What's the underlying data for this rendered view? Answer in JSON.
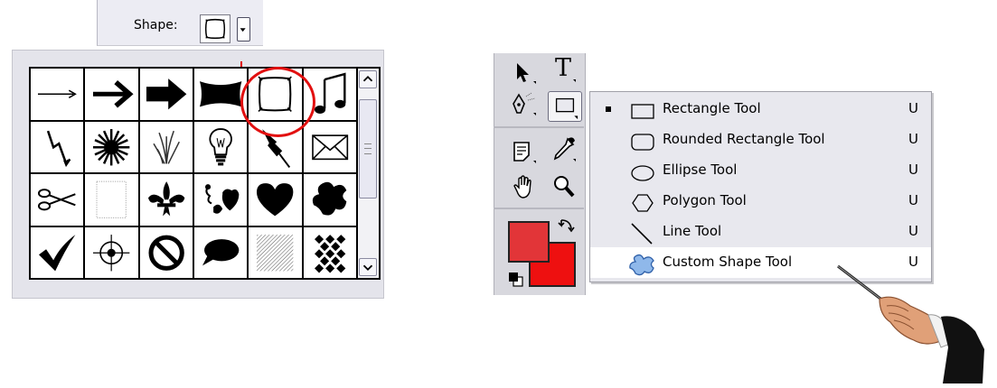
{
  "options_bar": {
    "shape_label": "Shape:",
    "dropdown_icon": "triangle-down-icon"
  },
  "shape_picker": {
    "shapes": [
      "thin-arrow-icon",
      "bold-arrow-icon",
      "heavy-arrow-icon",
      "banner-icon",
      "frame-icon",
      "music-note-icon",
      "lightning-icon",
      "starburst-icon",
      "grass-icon",
      "lightbulb-icon",
      "pushpin-icon",
      "envelope-icon",
      "scissors-icon",
      "dotted-frame-icon",
      "fleur-de-lis-icon",
      "floral-heart-icon",
      "heart-icon",
      "puzzle-blob-icon",
      "checkmark-icon",
      "crosshair-icon",
      "no-symbol-icon",
      "speech-bubble-icon",
      "hatched-square-icon",
      "diamond-grid-icon"
    ],
    "selected_index": 4,
    "highlight_color": "#e21010"
  },
  "toolbox": {
    "type_tool_glyph": "T",
    "foreground_color": "#e23538",
    "background_color": "#ee1010",
    "tools": [
      "move-icon",
      "type-icon",
      "pen-icon",
      "rectangle-icon",
      "notes-icon",
      "eyedropper-icon",
      "hand-icon",
      "zoom-icon"
    ]
  },
  "menu": {
    "items": [
      {
        "label": "Rectangle Tool",
        "key": "U",
        "icon": "rectangle-icon"
      },
      {
        "label": "Rounded Rectangle Tool",
        "key": "U",
        "icon": "rounded-rectangle-icon"
      },
      {
        "label": "Ellipse Tool",
        "key": "U",
        "icon": "ellipse-icon"
      },
      {
        "label": "Polygon Tool",
        "key": "U",
        "icon": "polygon-icon"
      },
      {
        "label": "Line Tool",
        "key": "U",
        "icon": "line-icon"
      },
      {
        "label": "Custom Shape Tool",
        "key": "U",
        "icon": "custom-shape-icon"
      }
    ],
    "checked_index": 0,
    "highlighted_index": 5
  }
}
